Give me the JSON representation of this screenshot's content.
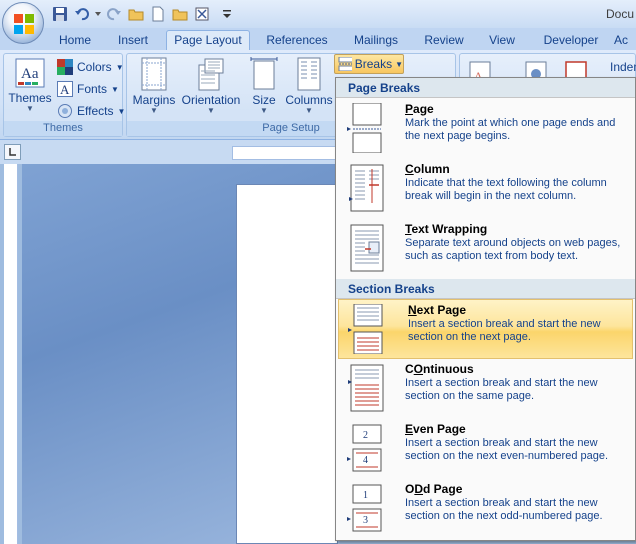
{
  "title_bar": {
    "title": "Docu"
  },
  "tabs": [
    {
      "label": "Home"
    },
    {
      "label": "Insert"
    },
    {
      "label": "Page Layout"
    },
    {
      "label": "References"
    },
    {
      "label": "Mailings"
    },
    {
      "label": "Review"
    },
    {
      "label": "View"
    },
    {
      "label": "Developer"
    },
    {
      "label": "Ac"
    }
  ],
  "ribbon": {
    "themes_group": {
      "label": "Themes",
      "themes_button": "Themes",
      "colors_button": "Colors",
      "fonts_button": "Fonts",
      "effects_button": "Effects"
    },
    "page_setup_group": {
      "label": "Page Setup",
      "margins": "Margins",
      "orientation": "Orientation",
      "size": "Size",
      "columns": "Columns",
      "breaks": "Breaks"
    },
    "right_partial": "Inden"
  },
  "breaks_menu": {
    "page_breaks_header": "Page Breaks",
    "section_breaks_header": "Section Breaks",
    "items": [
      {
        "key": "P",
        "rest": "age",
        "desc": "Mark the point at which one page ends and the next page begins.",
        "icon": "page-break-icon"
      },
      {
        "key": "C",
        "rest": "olumn",
        "desc": "Indicate that the text following the column break will begin in the next column.",
        "icon": "column-break-icon"
      },
      {
        "key": "T",
        "rest": "ext Wrapping",
        "desc": "Separate text around objects on web pages, such as caption text from body text.",
        "icon": "text-wrapping-icon"
      },
      {
        "key": "N",
        "rest": "ext Page",
        "desc": "Insert a section break and start the new section on the next page.",
        "icon": "next-page-icon",
        "highlighted": true
      },
      {
        "key": "O",
        "rest": "ntinuous",
        "prefix": "C",
        "desc": "Insert a section break and start the new section on the same page.",
        "icon": "continuous-icon"
      },
      {
        "key": "E",
        "rest": "ven Page",
        "desc": "Insert a section break and start the new section on the next even-numbered page.",
        "icon": "even-page-icon"
      },
      {
        "key": "D",
        "rest": "d Page",
        "prefix": "O",
        "desc": "Insert a section break and start the new section on the next odd-numbered page.",
        "icon": "odd-page-icon"
      }
    ]
  },
  "colors": {
    "accent": "#15428b",
    "highlight": "#fbd56b",
    "ribbon_bg": "#d2e2f7"
  }
}
